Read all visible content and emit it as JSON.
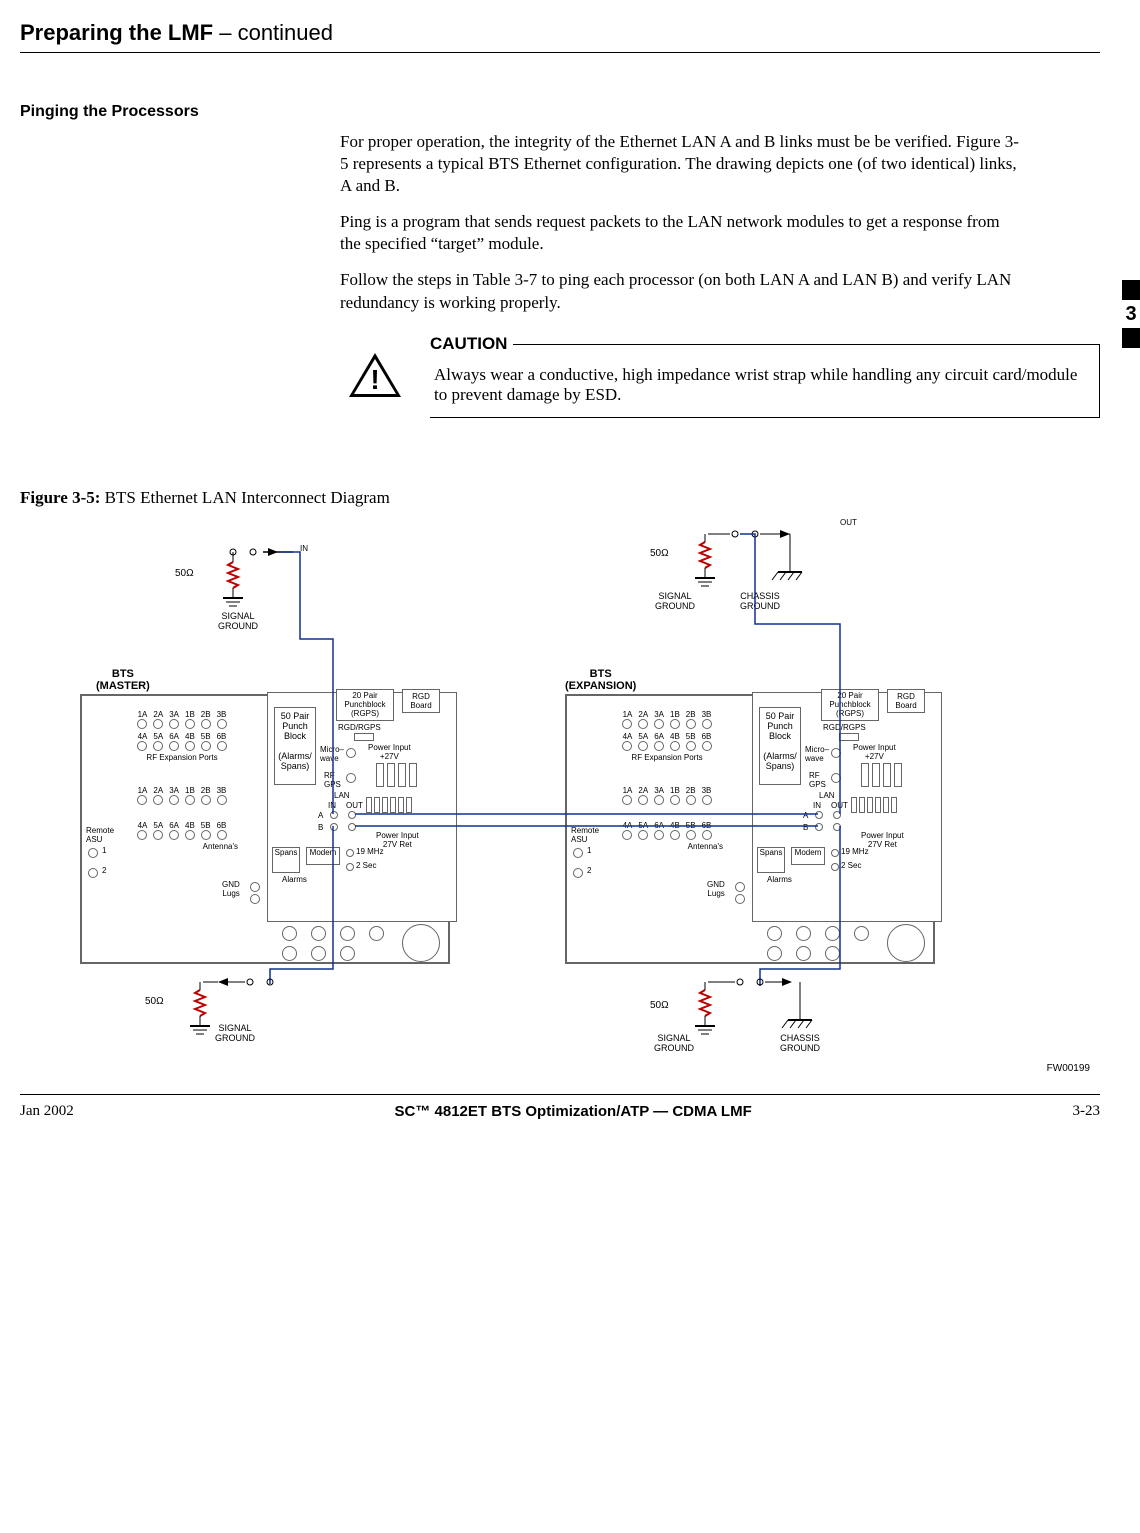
{
  "header": {
    "title_bold": "Preparing the LMF",
    "title_cont": " – continued"
  },
  "section": {
    "heading": "Pinging the Processors",
    "p1": "For proper operation, the integrity of the Ethernet LAN A and B links must be be verified. Figure 3-5 represents a typical BTS Ethernet configuration. The drawing depicts one (of two identical) links, A and B.",
    "p2": "Ping is a program that sends request packets to the LAN network modules to get a response from the specified “target” module.",
    "p3": "Follow the steps in Table 3-7 to ping each processor (on both LAN A and LAN B) and verify LAN redundancy is working properly."
  },
  "caution": {
    "label": "CAUTION",
    "text": "Always wear a conductive, high impedance wrist strap while handling any circuit card/module to prevent damage by ESD."
  },
  "sidetab": {
    "num": "3"
  },
  "figure": {
    "label_bold": "Figure 3-5:",
    "label_rest": " BTS Ethernet LAN Interconnect Diagram",
    "code": "FW00199"
  },
  "diagram": {
    "in_label": "IN",
    "out_label": "OUT",
    "resistor": "50Ω",
    "signal_ground": "SIGNAL\nGROUND",
    "chassis_ground": "CHASSIS\nGROUND",
    "bts_master": "BTS\n(MASTER)",
    "bts_expansion": "BTS\n(EXPANSION)",
    "row1": [
      "1A",
      "2A",
      "3A",
      "1B",
      "2B",
      "3B"
    ],
    "row2": [
      "4A",
      "5A",
      "6A",
      "4B",
      "5B",
      "6B"
    ],
    "rf_exp": "RF Expansion Ports",
    "antennas": "Antenna's",
    "remote_asu": "Remote\nASU",
    "num1": "1",
    "num2": "2",
    "gnd_lugs": "GND\nLugs",
    "punch50": "50 Pair\nPunch\nBlock",
    "alarms_spans": "(Alarms/\nSpans)",
    "punch20": "20 Pair\nPunchblock\n(RGPS)",
    "rgd_board": "RGD\nBoard",
    "rgd_rgps": "RGD/RGPS",
    "microwave": "Micro–\nwave",
    "rf_gps": "RF\nGPS",
    "power_in_27": "Power Input\n+27V",
    "power_ret": "Power Input\n27V Ret",
    "lan": "LAN",
    "lan_in": "IN",
    "lan_out": "OUT",
    "a": "A",
    "b": "B",
    "spans": "Spans",
    "alarms": "Alarms",
    "modem": "Modem",
    "mhz19": "19 MHz",
    "sec2": "2 Sec"
  },
  "footer": {
    "date": "Jan 2002",
    "center": "SC™ 4812ET BTS Optimization/ATP — CDMA LMF",
    "page": "3-23"
  }
}
